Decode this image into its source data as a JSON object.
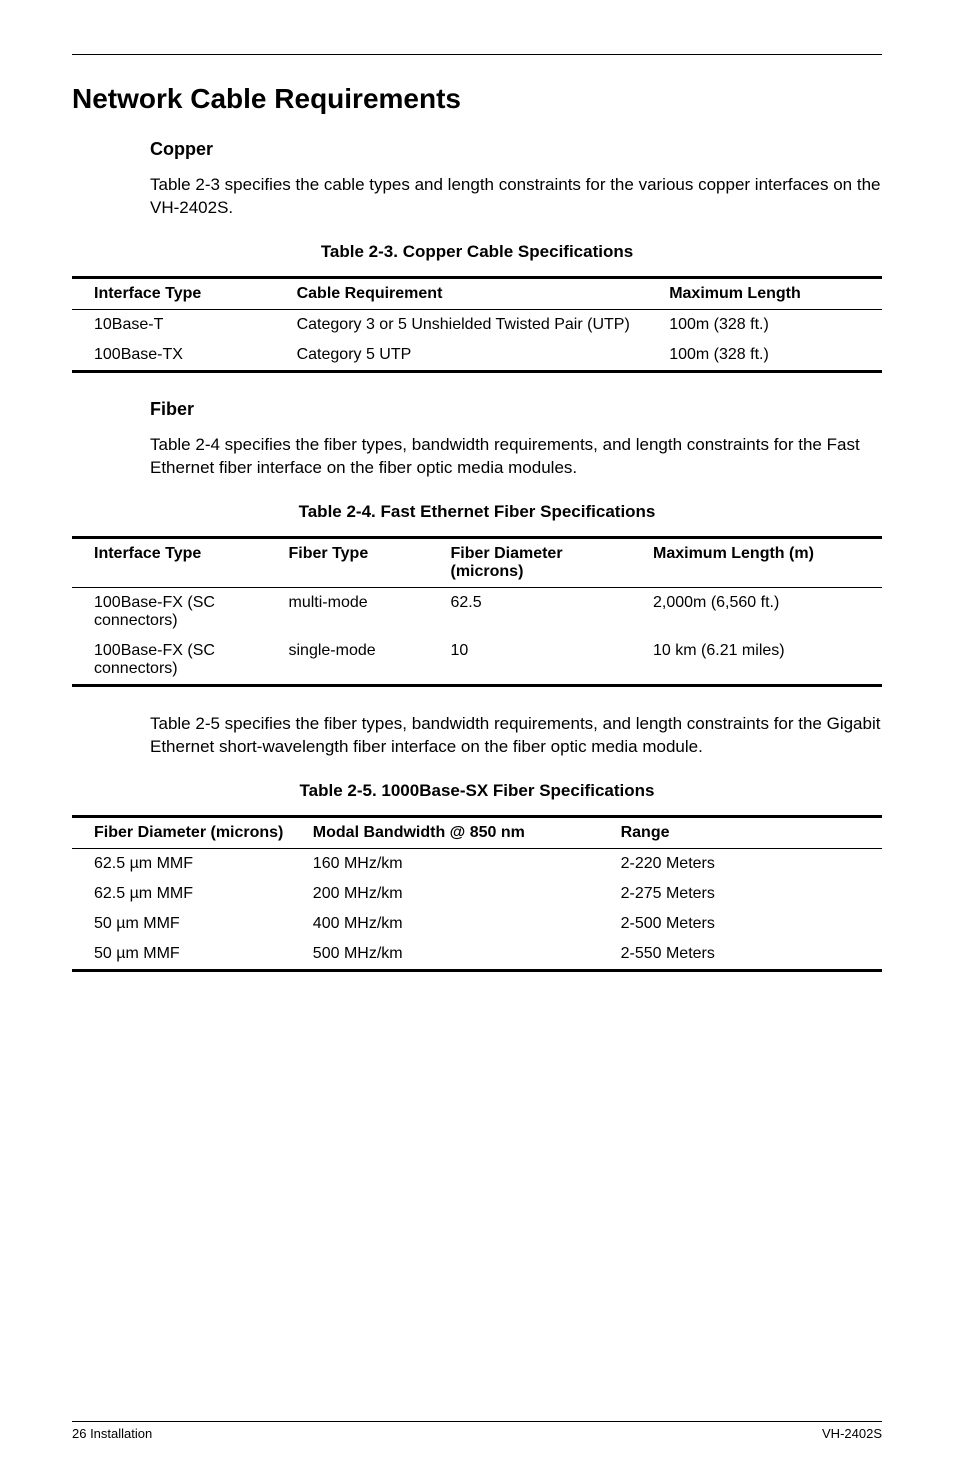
{
  "section_title": "Network Cable Requirements",
  "copper": {
    "heading": "Copper",
    "intro": "Table 2-3 specifies the cable types and length constraints for the various copper interfaces on the VH-2402S.",
    "caption": "Table 2-3.  Copper Cable Specifications",
    "headers": {
      "c0": "Interface Type",
      "c1": "Cable Requirement",
      "c2": "Maximum Length"
    },
    "rows": [
      {
        "c0": "10Base-T",
        "c1": "Category 3 or 5 Unshielded Twisted Pair (UTP)",
        "c2": "100m (328 ft.)"
      },
      {
        "c0": "100Base-TX",
        "c1": "Category 5 UTP",
        "c2": "100m (328 ft.)"
      }
    ]
  },
  "fiber": {
    "heading": "Fiber",
    "intro": "Table 2-4 specifies the fiber types, bandwidth requirements, and length constraints for the Fast Ethernet fiber interface on the fiber optic media modules.",
    "caption4": "Table 2-4.  Fast Ethernet Fiber Specifications",
    "headers4": {
      "c0": "Interface Type",
      "c1": "Fiber Type",
      "c2": "Fiber Diameter (microns)",
      "c3": "Maximum Length (m)"
    },
    "rows4": [
      {
        "c0": "100Base-FX (SC connectors)",
        "c1": "multi-mode",
        "c2": "62.5",
        "c3": "2,000m (6,560 ft.)"
      },
      {
        "c0": "100Base-FX (SC connectors)",
        "c1": "single-mode",
        "c2": "10",
        "c3": "10 km (6.21 miles)"
      }
    ],
    "intro5": "Table 2-5 specifies the fiber types, bandwidth requirements, and length constraints for the Gigabit Ethernet short-wavelength fiber interface on the fiber optic media module.",
    "caption5": "Table 2-5.  1000Base-SX Fiber Specifications",
    "headers5": {
      "c0": "Fiber Diameter (microns)",
      "c1": "Modal Bandwidth @ 850 nm",
      "c2": "Range"
    },
    "rows5": [
      {
        "c0": "62.5 µm MMF",
        "c1": "160 MHz/km",
        "c2": "2-220 Meters"
      },
      {
        "c0": "62.5 µm MMF",
        "c1": "200 MHz/km",
        "c2": "2-275 Meters"
      },
      {
        "c0": "50 µm MMF",
        "c1": "400 MHz/km",
        "c2": "2-500 Meters"
      },
      {
        "c0": "50 µm MMF",
        "c1": "500 MHz/km",
        "c2": "2-550 Meters"
      }
    ]
  },
  "footer": {
    "left": "26  Installation",
    "right": "VH-2402S"
  }
}
